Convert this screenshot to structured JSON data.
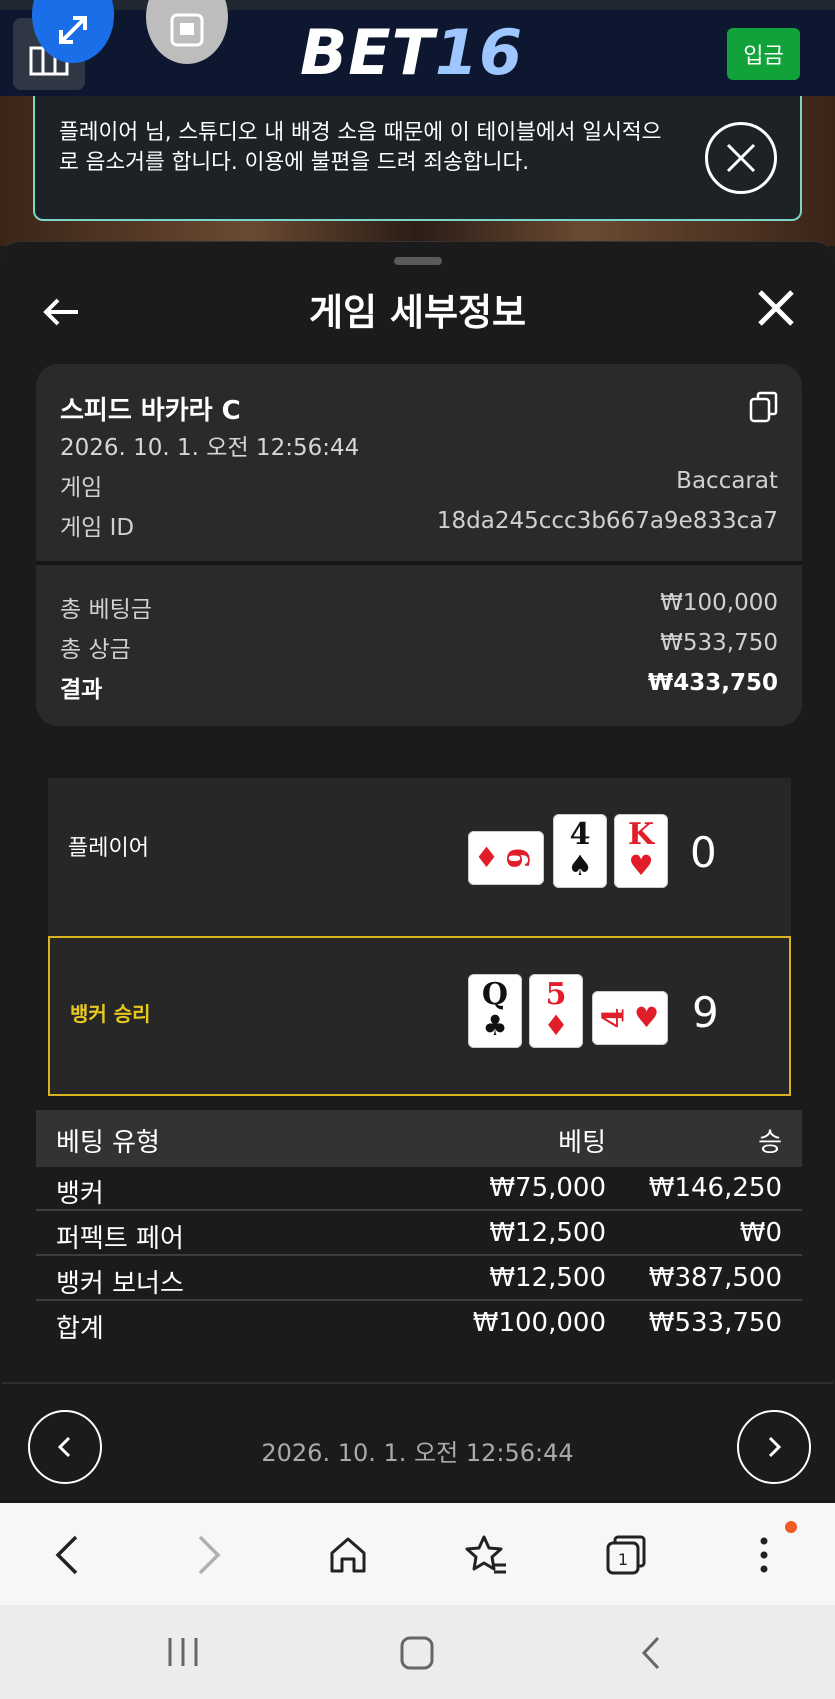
{
  "site": {
    "logo_main": "BET",
    "logo_num": "16",
    "deposit_label": "입금"
  },
  "notice": {
    "text": "플레이어 님, 스튜디오 내 배경 소음 때문에 이 테이블에서 일시적으로 음소거를 합니다. 이용에 불편을 드려 죄송합니다."
  },
  "sheet": {
    "title": "게임 세부정보"
  },
  "summary": {
    "game_name": "스피드 바카라 C",
    "datetime": "2026. 10. 1. 오전 12:56:44",
    "game_label": "게임",
    "game_value": "Baccarat",
    "game_id_label": "게임 ID",
    "game_id_value": "18da245ccc3b667a9e833ca7",
    "total_bet_label": "총 베팅금",
    "total_bet_value": "₩100,000",
    "total_win_label": "총 상금",
    "total_win_value": "₩533,750",
    "result_label": "결과",
    "result_value": "₩433,750"
  },
  "hands": {
    "player": {
      "label": "플레이어",
      "score": "0",
      "cards": [
        {
          "rank": "6",
          "suit": "♦",
          "color": "red",
          "sideways": true
        },
        {
          "rank": "4",
          "suit": "♠",
          "color": "black",
          "sideways": false
        },
        {
          "rank": "K",
          "suit": "♥",
          "color": "red",
          "sideways": false
        }
      ]
    },
    "banker": {
      "label": "뱅커 승리",
      "score": "9",
      "cards": [
        {
          "rank": "Q",
          "suit": "♣",
          "color": "black",
          "sideways": false
        },
        {
          "rank": "5",
          "suit": "♦",
          "color": "red",
          "sideways": false
        },
        {
          "rank": "4",
          "suit": "♥",
          "color": "red",
          "sideways": true
        }
      ]
    }
  },
  "bets": {
    "headers": [
      "베팅 유형",
      "베팅",
      "승"
    ],
    "rows": [
      [
        "뱅커",
        "₩75,000",
        "₩146,250"
      ],
      [
        "퍼펙트 페어",
        "₩12,500",
        "₩0"
      ],
      [
        "뱅커 보너스",
        "₩12,500",
        "₩387,500"
      ]
    ],
    "total": [
      "합계",
      "₩100,000",
      "₩533,750"
    ]
  },
  "footer": {
    "datetime": "2026. 10. 1. 오전 12:56:44"
  },
  "browser": {
    "tab_count": "1"
  },
  "colors": {
    "accent_green": "#12a23a",
    "winner_yellow": "#d9b31e",
    "notice_border": "#79d6c8",
    "card_red": "#e21d2a"
  }
}
